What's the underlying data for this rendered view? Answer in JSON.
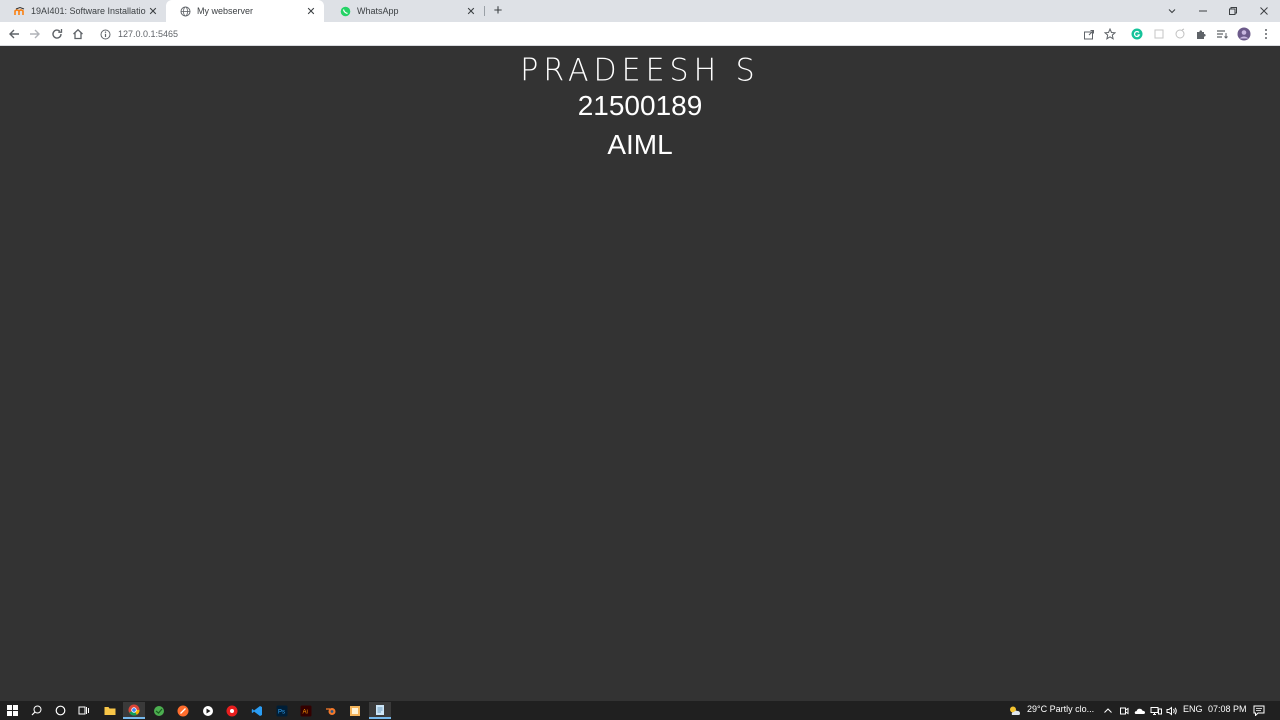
{
  "browser": {
    "tabs": [
      {
        "title": "19AI401: Software Installation",
        "icon": "moodle-icon",
        "active": false
      },
      {
        "title": "My webserver",
        "icon": "globe-icon",
        "active": true
      },
      {
        "title": "WhatsApp",
        "icon": "whatsapp-icon",
        "active": false
      }
    ],
    "new_tab": "+",
    "url": "127.0.0.1:5465"
  },
  "page": {
    "name": "PRADEESH S",
    "roll_number": "21500189",
    "department": "AIML",
    "background_color": "#333333",
    "text_color": "#ffffff"
  },
  "taskbar": {
    "weather": "29°C  Partly clo...",
    "language": "ENG",
    "time": "07:08 PM"
  }
}
